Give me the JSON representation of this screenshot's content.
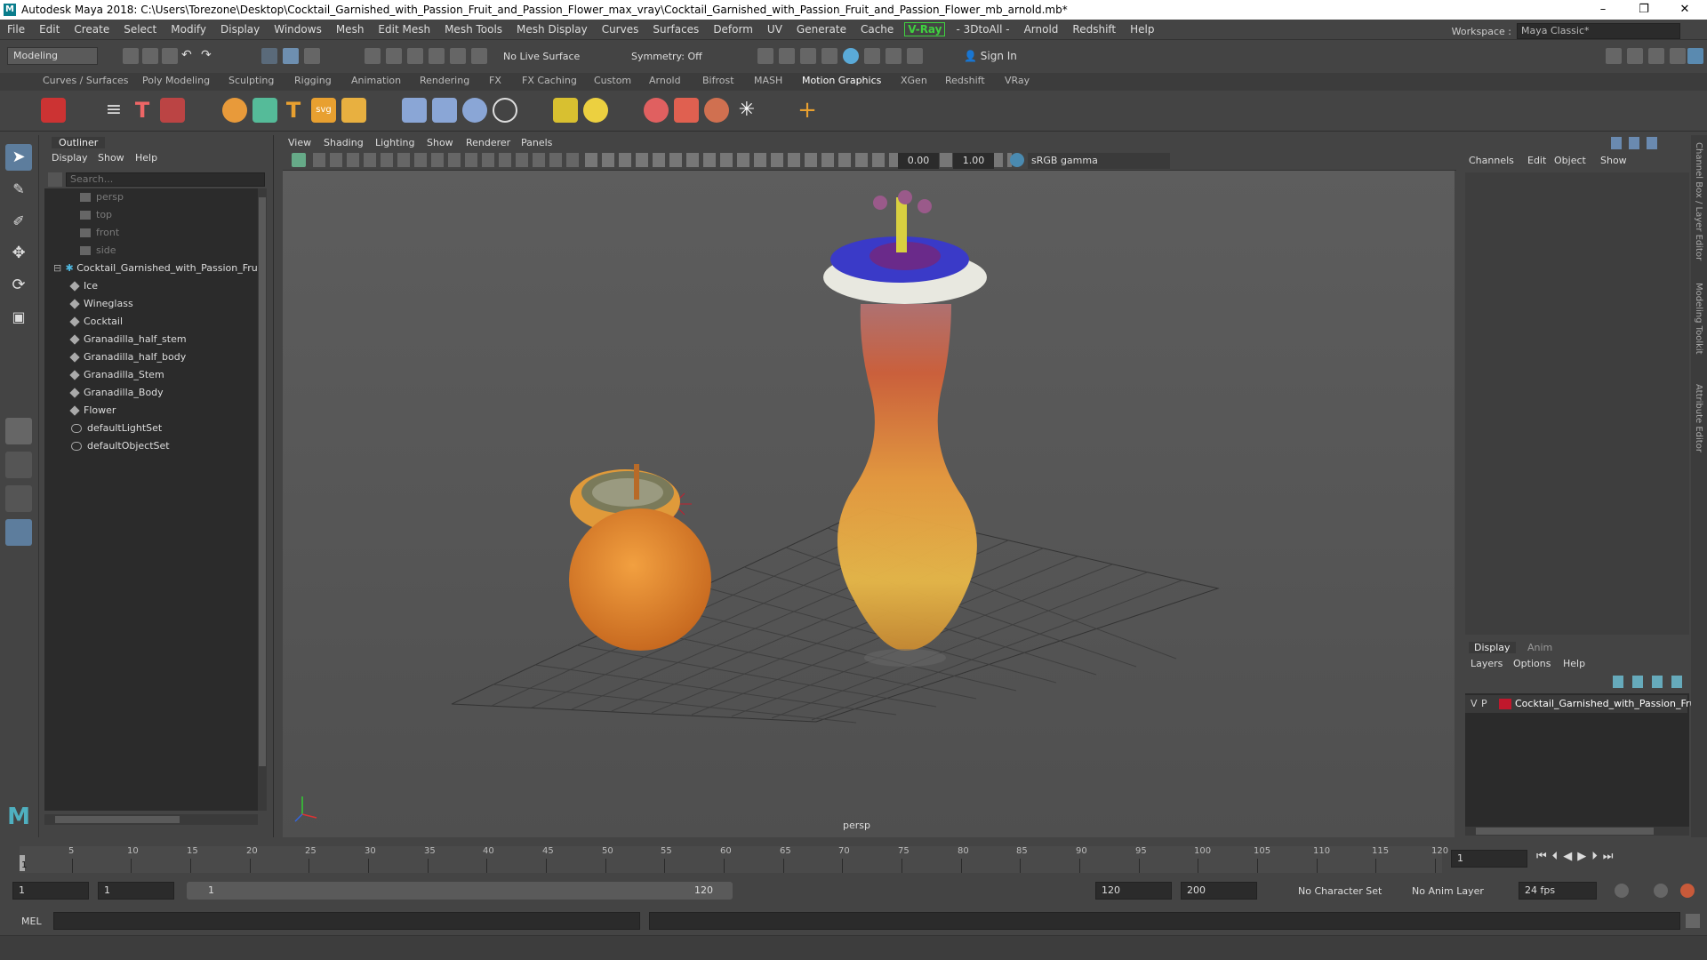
{
  "window": {
    "title": "Autodesk Maya 2018: C:\\Users\\Torezone\\Desktop\\Cocktail_Garnished_with_Passion_Fruit_and_Passion_Flower_max_vray\\Cocktail_Garnished_with_Passion_Fruit_and_Passion_Flower_mb_arnold.mb*",
    "controls": [
      "–",
      "❐",
      "✕"
    ]
  },
  "menubar": {
    "items": [
      "File",
      "Edit",
      "Create",
      "Select",
      "Modify",
      "Display",
      "Windows",
      "Mesh",
      "Edit Mesh",
      "Mesh Tools",
      "Mesh Display",
      "Curves",
      "Surfaces",
      "Deform",
      "UV",
      "Generate",
      "Cache",
      "V-Ray",
      "- 3DtoAll -",
      "Arnold",
      "Redshift",
      "Help"
    ],
    "workspace_label": "Workspace :",
    "workspace_value": "Maya Classic*"
  },
  "statusline": {
    "mode": "Modeling",
    "live_surface": "No Live Surface",
    "symmetry": "Symmetry: Off",
    "sign_in": "Sign In"
  },
  "shelf": {
    "tabs": [
      "Curves / Surfaces",
      "Poly Modeling",
      "Sculpting",
      "Rigging",
      "Animation",
      "Rendering",
      "FX",
      "FX Caching",
      "Custom",
      "Arnold",
      "Bifrost",
      "MASH",
      "Motion Graphics",
      "XGen",
      "Redshift",
      "VRay"
    ],
    "active_tab": "Motion Graphics",
    "svg_label": "svg"
  },
  "outliner": {
    "title": "Outliner",
    "menu": [
      "Display",
      "Show",
      "Help"
    ],
    "search_placeholder": "Search...",
    "cameras": [
      "persp",
      "top",
      "front",
      "side"
    ],
    "group": "Cocktail_Garnished_with_Passion_Fru",
    "children": [
      "Ice",
      "Wineglass",
      "Cocktail",
      "Granadilla_half_stem",
      "Granadilla_half_body",
      "Granadilla_Stem",
      "Granadilla_Body",
      "Flower"
    ],
    "sets": [
      "defaultLightSet",
      "defaultObjectSet"
    ]
  },
  "viewport": {
    "menu": [
      "View",
      "Shading",
      "Lighting",
      "Show",
      "Renderer",
      "Panels"
    ],
    "exposure": "0.00",
    "gamma": "1.00",
    "color_space": "sRGB gamma",
    "camera_label": "persp"
  },
  "channelbox": {
    "menu": [
      "Channels",
      "Edit",
      "Object",
      "Show"
    ]
  },
  "layers": {
    "tabs": [
      "Display",
      "Anim"
    ],
    "menu": [
      "Layers",
      "Options",
      "Help"
    ],
    "layer": {
      "v": "V",
      "p": "P",
      "name": "Cocktail_Garnished_with_Passion_Fru",
      "color": "#c0182c"
    }
  },
  "sidetabs": [
    "Channel Box / Layer Editor",
    "Modeling Toolkit",
    "Attribute Editor"
  ],
  "timeline": {
    "ticks": [
      "5",
      "10",
      "15",
      "20",
      "25",
      "30",
      "35",
      "40",
      "45",
      "50",
      "55",
      "60",
      "65",
      "70",
      "75",
      "80",
      "85",
      "90",
      "95",
      "100",
      "105",
      "110",
      "115",
      "120"
    ],
    "current_frame": "1",
    "start_marker": "1"
  },
  "range": {
    "start": "1",
    "playback_start": "1",
    "range_left": "1",
    "range_right": "120",
    "playback_end": "120",
    "end": "200",
    "character_set": "No Character Set",
    "anim_layer": "No Anim Layer",
    "fps": "24 fps"
  },
  "cmdline": {
    "label": "MEL"
  }
}
